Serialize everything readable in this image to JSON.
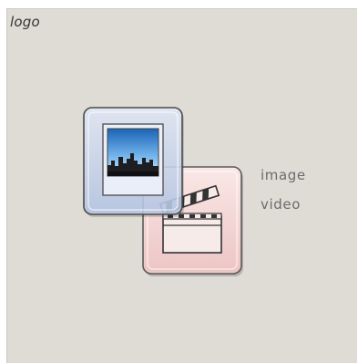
{
  "logo": {
    "label": "logo"
  },
  "media": {
    "icon_name": "image-video-icon",
    "lines": [
      "image",
      "video"
    ]
  },
  "colors": {
    "panel_background": "#dedcd4",
    "image_card": "#c9d6ee",
    "video_card": "#f0d6d6"
  }
}
